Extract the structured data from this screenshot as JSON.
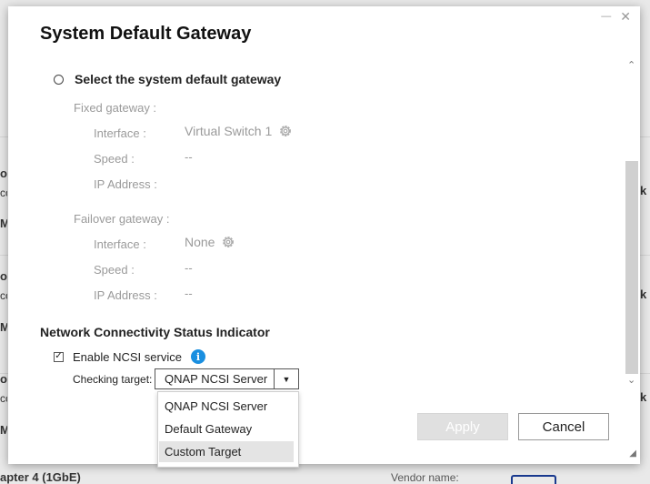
{
  "background": {
    "left_fragments": [
      "op",
      "cc",
      "Mb",
      "op",
      "cc",
      "Mb",
      "op",
      "cc",
      "Mb"
    ],
    "right_fragments": [
      "rk",
      "rk",
      "rk"
    ],
    "bottom_left": "apter 4 (1GbE)",
    "bottom_right": "Vendor name:"
  },
  "dialog": {
    "title": "System Default Gateway",
    "controls": {
      "minimize": "—",
      "close": "✕"
    },
    "radio_label": "Select the system default gateway",
    "fixed": {
      "heading": "Fixed gateway :",
      "interface_label": "Interface :",
      "interface_value": "Virtual Switch 1",
      "speed_label": "Speed :",
      "speed_value": "--",
      "ip_label": "IP Address :",
      "ip_value": ""
    },
    "failover": {
      "heading": "Failover gateway :",
      "interface_label": "Interface :",
      "interface_value": "None",
      "speed_label": "Speed :",
      "speed_value": "--",
      "ip_label": "IP Address :",
      "ip_value": "--"
    },
    "ncsi": {
      "section_title": "Network Connectivity Status Indicator",
      "enable_label": "Enable NCSI service",
      "enabled": true,
      "checking_target_label": "Checking target:",
      "selected_target": "QNAP NCSI Server",
      "options": [
        "QNAP NCSI Server",
        "Default Gateway",
        "Custom Target"
      ],
      "highlighted_option": "Custom Target"
    },
    "buttons": {
      "apply": "Apply",
      "cancel": "Cancel"
    },
    "icons": {
      "gear": "gear-icon",
      "info": "info-icon",
      "dropdown": "chevron-down-icon"
    }
  }
}
